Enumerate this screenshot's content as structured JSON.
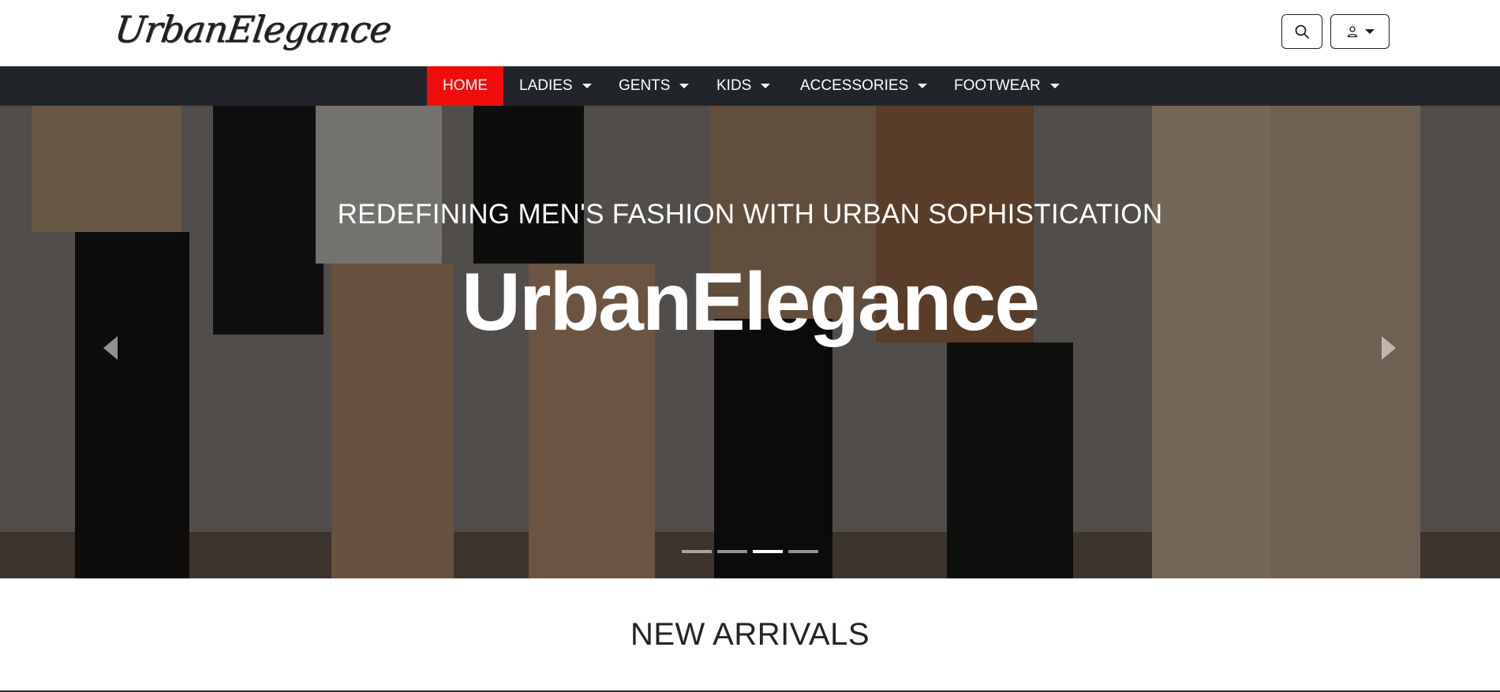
{
  "header": {
    "logo_text": "UrbanElegance",
    "search_icon": "search-icon",
    "user_icon": "user-icon"
  },
  "nav": {
    "items": [
      {
        "label": "HOME",
        "active": true,
        "dropdown": false
      },
      {
        "label": "LADIES",
        "active": false,
        "dropdown": true
      },
      {
        "label": "GENTS",
        "active": false,
        "dropdown": true
      },
      {
        "label": "KIDS",
        "active": false,
        "dropdown": true
      },
      {
        "label": "ACCESSORIES",
        "active": false,
        "dropdown": true
      },
      {
        "label": "FOOTWEAR",
        "active": false,
        "dropdown": true
      }
    ],
    "active_color": "#f20d0d",
    "bar_color": "#212529"
  },
  "hero": {
    "subtitle": "REDEFINING MEN'S FASHION WITH URBAN SOPHISTICATION",
    "title": "UrbanElegance",
    "prev_icon": "chevron-left-icon",
    "next_icon": "chevron-right-icon",
    "slide_count": 4,
    "active_slide": 3
  },
  "sections": {
    "new_arrivals_title": "NEW ARRIVALS"
  }
}
